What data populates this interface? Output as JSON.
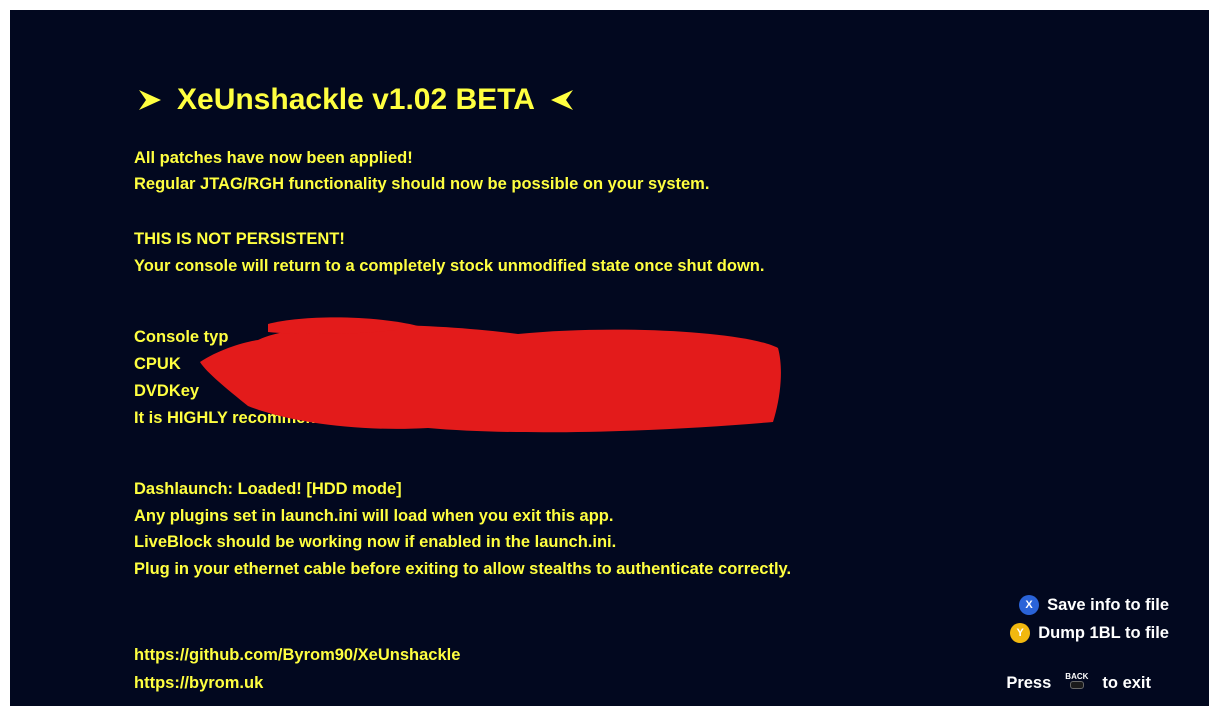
{
  "app": {
    "title": "XeUnshackle v1.02 BETA"
  },
  "messages": {
    "patched_1": "All patches have now been applied!",
    "patched_2": "Regular JTAG/RGH functionality should now be possible on your system.",
    "warn_1": "THIS IS NOT PERSISTENT!",
    "warn_2": "Your console will return to a completely stock unmodified state once shut down."
  },
  "console_info": {
    "console_type_label": "Console typ",
    "cpukey_label": "CPUK",
    "dvdkey_label": "DVDKey",
    "recommend": "It is HIGHLY recommended that you now go dump a copy of your nand!"
  },
  "dashlaunch": {
    "status": "Dashlaunch: Loaded! [HDD mode]",
    "line_1": "Any plugins set in launch.ini will load when you exit this app.",
    "line_2": "LiveBlock should be working now if enabled in the launch.ini.",
    "line_3": "Plug in your ethernet cable before exiting to allow stealths to authenticate correctly."
  },
  "links": {
    "github": "https://github.com/Byrom90/XeUnshackle",
    "site": "https://byrom.uk"
  },
  "controls": {
    "x_glyph": "X",
    "x_label": "Save info to file",
    "y_glyph": "Y",
    "y_label": "Dump 1BL to file",
    "press": "Press",
    "back_glyph": "BACK",
    "exit": "to exit"
  },
  "colors": {
    "background": "#02081f",
    "text": "#ffff40",
    "redaction": "#e31b1b",
    "x_button": "#2a63d8",
    "y_button": "#f2b80f"
  }
}
